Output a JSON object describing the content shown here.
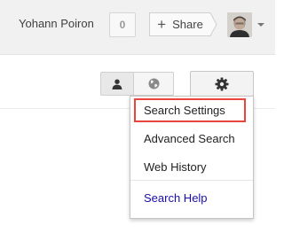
{
  "header": {
    "user_name": "Yohann Poiron",
    "notification_count": "0",
    "share_label": "Share",
    "share_icon": "plus-icon",
    "avatar_icon": "user-avatar",
    "avatar_menu_icon": "caret-down-icon"
  },
  "toolbar": {
    "personal_results_icon": "person-icon",
    "world_results_icon": "globe-icon",
    "settings_icon": "gear-icon"
  },
  "settings_menu": {
    "items": [
      {
        "label": "Search Settings",
        "highlighted": true
      },
      {
        "label": "Advanced Search"
      },
      {
        "label": "Web History"
      },
      {
        "label": "Search Help",
        "link": true
      }
    ]
  },
  "colors": {
    "highlight_border": "#e8453c",
    "link": "#1a0dab",
    "topbar_bg": "#f1f1f1"
  }
}
